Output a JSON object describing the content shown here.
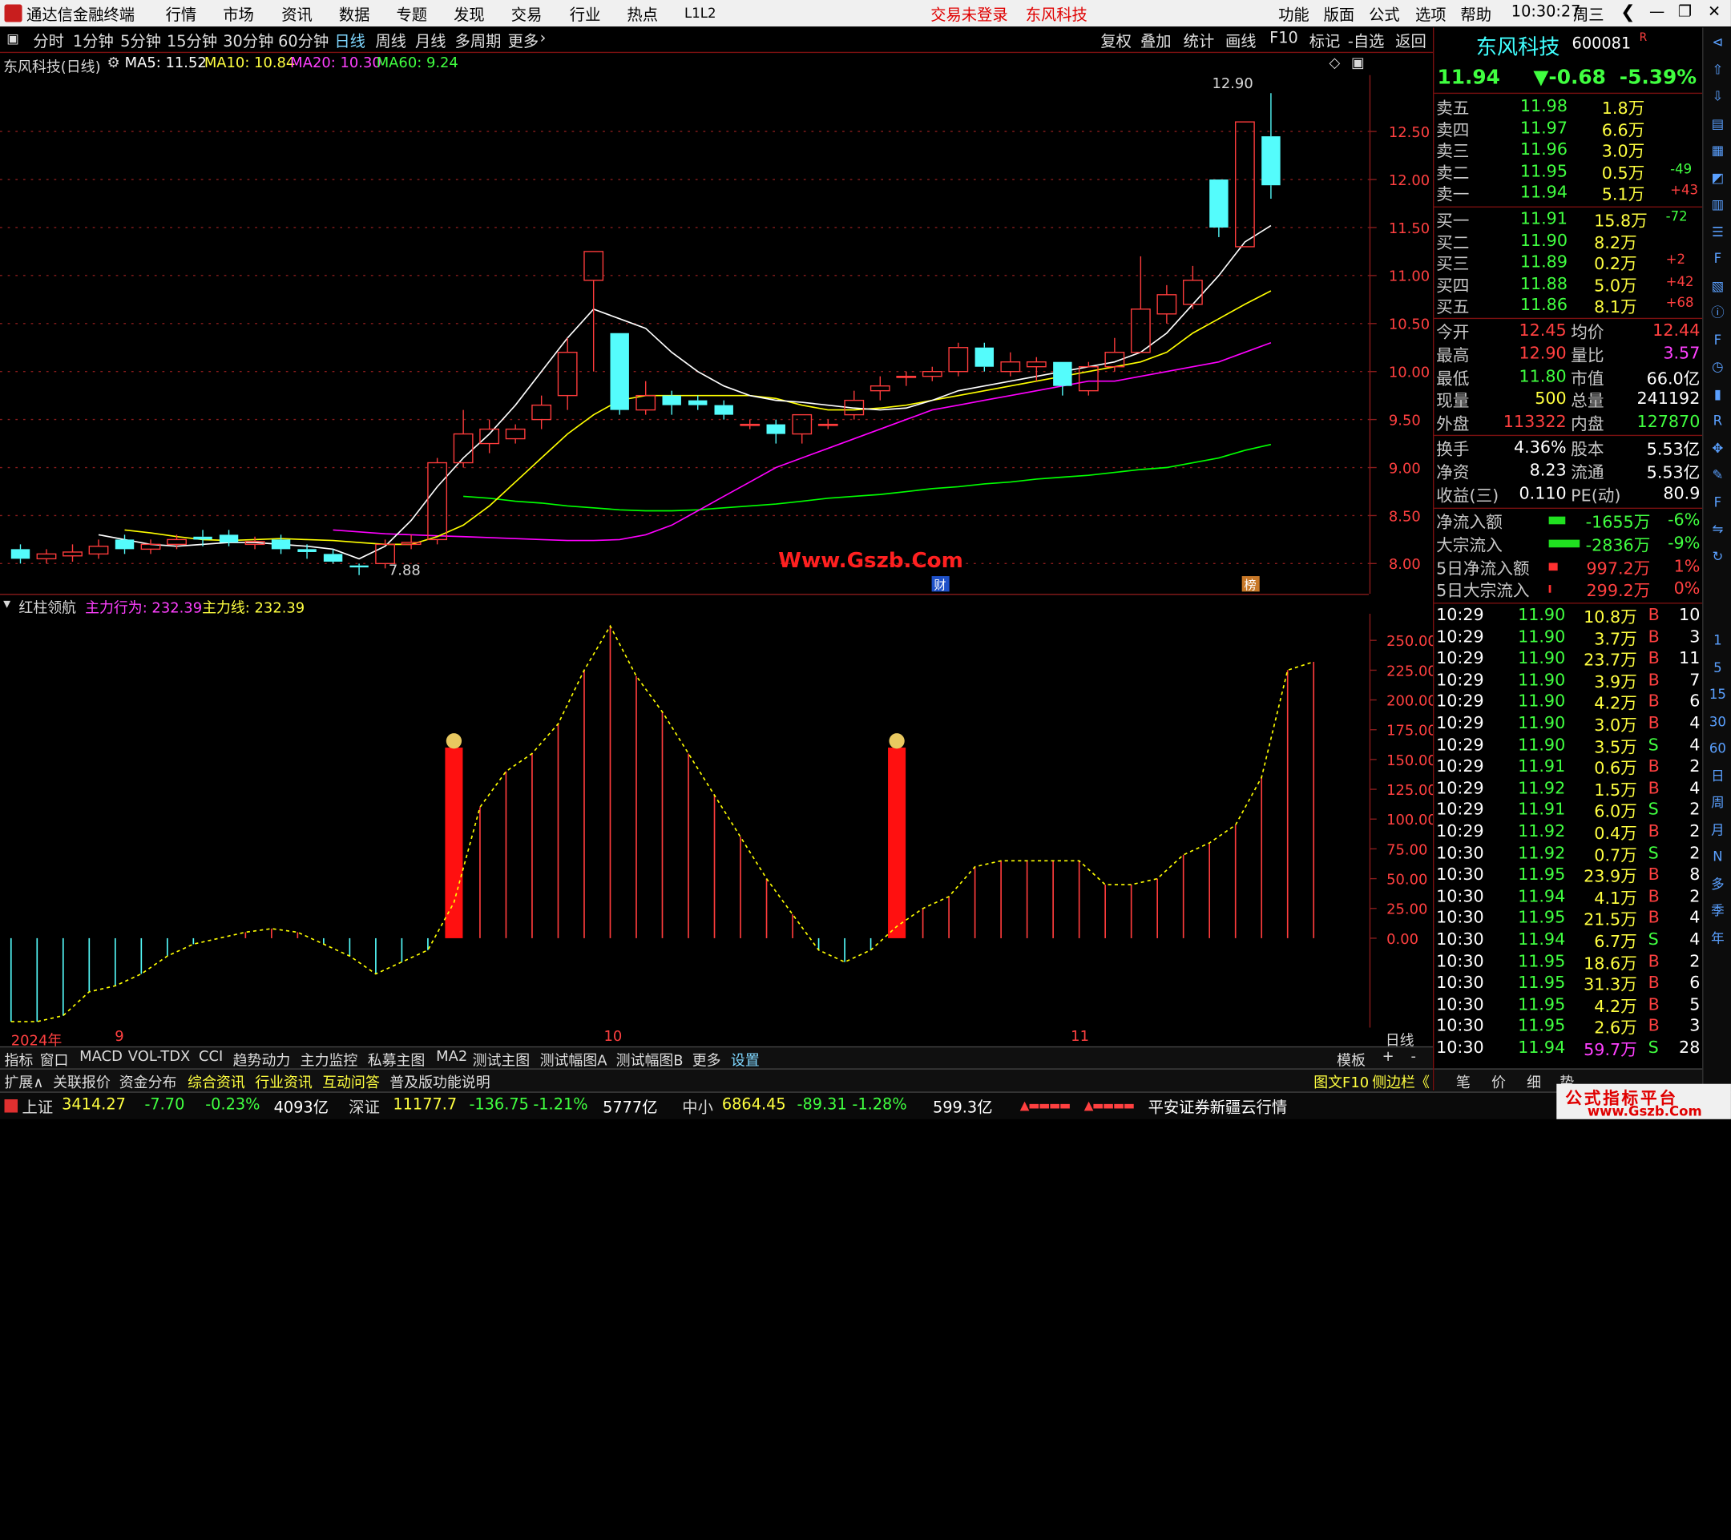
{
  "titlebar": {
    "app_name": "通达信金融终端",
    "menus": [
      "行情",
      "市场",
      "资讯",
      "数据",
      "专题",
      "发现",
      "交易",
      "行业",
      "热点",
      "L1L2"
    ],
    "notice": "交易未登录",
    "stock": "东风科技",
    "right_menus": [
      "功能",
      "版面",
      "公式",
      "选项",
      "帮助"
    ],
    "time": "10:30:27",
    "weekday": "周三"
  },
  "periods": [
    "分时",
    "1分钟",
    "5分钟",
    "15分钟",
    "30分钟",
    "60分钟",
    "日线",
    "周线",
    "月线",
    "多周期",
    "更多"
  ],
  "active_period": "日线",
  "right_tools": [
    "复权",
    "叠加",
    "统计",
    "画线",
    "F10",
    "标记",
    "-自选",
    "返回"
  ],
  "chart_info": {
    "title": "东风科技(日线)",
    "ma5": "MA5: 11.52",
    "ma10": "MA10: 10.84",
    "ma20": "MA20: 10.30",
    "ma60": "MA60: 9.24",
    "high_label": "12.90",
    "low_label": "7.88",
    "watermark": "Www.Gszb.Com",
    "marker1": "财",
    "marker2": "榜"
  },
  "ind_info": {
    "name": "红柱领航",
    "line1": "主力行为: 232.39",
    "line2": "主力线: 232.39"
  },
  "chart_data": [
    {
      "type": "candlestick",
      "y_axis": [
        "12.50",
        "12.00",
        "11.50",
        "11.00",
        "10.50",
        "10.00",
        "9.50",
        "9.00",
        "8.50",
        "8.00"
      ],
      "ylim": [
        7.8,
        12.95
      ],
      "candles": [
        [
          8.15,
          8.05,
          8.2,
          8.0
        ],
        [
          8.05,
          8.1,
          8.15,
          8.0
        ],
        [
          8.08,
          8.12,
          8.2,
          8.02
        ],
        [
          8.1,
          8.18,
          8.25,
          8.05
        ],
        [
          8.25,
          8.15,
          8.3,
          8.1
        ],
        [
          8.15,
          8.2,
          8.25,
          8.1
        ],
        [
          8.2,
          8.25,
          8.3,
          8.15
        ],
        [
          8.28,
          8.25,
          8.35,
          8.18
        ],
        [
          8.3,
          8.22,
          8.35,
          8.18
        ],
        [
          8.2,
          8.23,
          8.28,
          8.15
        ],
        [
          8.25,
          8.15,
          8.3,
          8.1
        ],
        [
          8.15,
          8.12,
          8.2,
          8.05
        ],
        [
          8.1,
          8.02,
          8.15,
          8.0
        ],
        [
          7.98,
          7.96,
          8.0,
          7.88
        ],
        [
          8.0,
          8.2,
          8.25,
          7.95
        ],
        [
          8.2,
          8.22,
          8.3,
          8.15
        ],
        [
          8.25,
          9.05,
          9.1,
          8.2
        ],
        [
          9.05,
          9.35,
          9.6,
          9.0
        ],
        [
          9.25,
          9.4,
          9.5,
          9.15
        ],
        [
          9.3,
          9.4,
          9.45,
          9.25
        ],
        [
          9.5,
          9.65,
          9.75,
          9.4
        ],
        [
          9.75,
          10.2,
          10.35,
          9.6
        ],
        [
          10.95,
          11.25,
          11.25,
          10.0
        ],
        [
          10.4,
          9.6,
          10.4,
          9.55
        ],
        [
          9.6,
          9.75,
          9.9,
          9.55
        ],
        [
          9.75,
          9.65,
          9.8,
          9.55
        ],
        [
          9.7,
          9.65,
          9.75,
          9.6
        ],
        [
          9.65,
          9.55,
          9.7,
          9.5
        ],
        [
          9.45,
          9.45,
          9.5,
          9.4
        ],
        [
          9.45,
          9.35,
          9.5,
          9.25
        ],
        [
          9.35,
          9.55,
          9.55,
          9.25
        ],
        [
          9.45,
          9.45,
          9.5,
          9.4
        ],
        [
          9.55,
          9.7,
          9.8,
          9.5
        ],
        [
          9.8,
          9.85,
          9.95,
          9.7
        ],
        [
          9.95,
          9.95,
          10.0,
          9.85
        ],
        [
          9.95,
          10.0,
          10.05,
          9.9
        ],
        [
          10.0,
          10.25,
          10.3,
          9.95
        ],
        [
          10.25,
          10.05,
          10.3,
          10.0
        ],
        [
          10.0,
          10.1,
          10.2,
          9.95
        ],
        [
          10.05,
          10.1,
          10.15,
          9.9
        ],
        [
          10.1,
          9.85,
          10.1,
          9.75
        ],
        [
          9.8,
          10.05,
          10.1,
          9.75
        ],
        [
          10.05,
          10.2,
          10.35,
          10.0
        ],
        [
          10.2,
          10.65,
          11.2,
          10.2
        ],
        [
          10.6,
          10.8,
          10.9,
          10.5
        ],
        [
          10.7,
          10.95,
          11.1,
          10.65
        ],
        [
          12.0,
          11.5,
          12.0,
          11.4
        ],
        [
          11.3,
          12.6,
          12.6,
          11.3
        ],
        [
          12.45,
          11.94,
          12.9,
          11.8
        ]
      ],
      "ma5": [
        8.3,
        8.25,
        8.2,
        8.18,
        8.2,
        8.22,
        8.22,
        8.2,
        8.18,
        8.15,
        8.05,
        8.18,
        8.45,
        8.8,
        9.1,
        9.35,
        9.65,
        10.0,
        10.35,
        10.65,
        10.55,
        10.45,
        10.2,
        10.0,
        9.85,
        9.75,
        9.7,
        9.68,
        9.65,
        9.62,
        9.6,
        9.62,
        9.7,
        9.8,
        9.85,
        9.9,
        9.95,
        10.0,
        10.05,
        10.1,
        10.2,
        10.4,
        10.7,
        11.0,
        11.35,
        11.52
      ],
      "ma10": [
        8.35,
        8.32,
        8.28,
        8.25,
        8.24,
        8.25,
        8.26,
        8.25,
        8.24,
        8.22,
        8.2,
        8.2,
        8.28,
        8.4,
        8.6,
        8.85,
        9.1,
        9.35,
        9.55,
        9.7,
        9.75,
        9.75,
        9.75,
        9.75,
        9.75,
        9.72,
        9.65,
        9.6,
        9.6,
        9.62,
        9.65,
        9.7,
        9.75,
        9.8,
        9.85,
        9.9,
        9.95,
        10.0,
        10.05,
        10.1,
        10.2,
        10.4,
        10.55,
        10.7,
        10.84
      ],
      "ma20": [
        8.35,
        8.33,
        8.31,
        8.3,
        8.29,
        8.28,
        8.27,
        8.26,
        8.25,
        8.24,
        8.24,
        8.25,
        8.3,
        8.4,
        8.55,
        8.7,
        8.85,
        9.0,
        9.1,
        9.2,
        9.3,
        9.4,
        9.5,
        9.6,
        9.65,
        9.7,
        9.75,
        9.8,
        9.85,
        9.9,
        9.9,
        9.95,
        10.0,
        10.05,
        10.1,
        10.2,
        10.3
      ],
      "ma60": [
        8.7,
        8.68,
        8.65,
        8.63,
        8.6,
        8.58,
        8.56,
        8.55,
        8.55,
        8.56,
        8.58,
        8.6,
        8.62,
        8.65,
        8.68,
        8.7,
        8.72,
        8.75,
        8.78,
        8.8,
        8.83,
        8.85,
        8.88,
        8.9,
        8.92,
        8.95,
        8.98,
        9.0,
        9.05,
        9.1,
        9.18,
        9.24
      ]
    },
    {
      "type": "bar",
      "y_axis": [
        "250.00",
        "225.00",
        "200.00",
        "175.00",
        "150.00",
        "125.00",
        "100.00",
        "75.00",
        "50.00",
        "25.00",
        "0.00"
      ],
      "ylim": [
        -75,
        265
      ],
      "values": [
        -70,
        -70,
        -65,
        -45,
        -40,
        -30,
        -15,
        -5,
        0,
        5,
        8,
        5,
        -5,
        -15,
        -30,
        -20,
        -10,
        30,
        110,
        140,
        155,
        180,
        225,
        262,
        220,
        190,
        155,
        120,
        85,
        50,
        20,
        -10,
        -20,
        -10,
        10,
        25,
        35,
        60,
        65,
        65,
        65,
        65,
        45,
        45,
        50,
        70,
        80,
        95,
        135,
        225,
        232
      ],
      "red_columns": [
        17,
        34
      ]
    }
  ],
  "x_labels": [
    "2024年",
    "9",
    "10",
    "11"
  ],
  "x_right": "日线",
  "tabs1": [
    "指标",
    "窗口",
    "MACD",
    "VOL-TDX",
    "CCI",
    "趋势动力",
    "主力监控",
    "私募主图",
    "MA2",
    "测试主图",
    "测试幅图A",
    "测试幅图B",
    "更多",
    "设置"
  ],
  "tabs1_right": [
    "模板",
    "+",
    "-"
  ],
  "tabs2": [
    "扩展∧",
    "关联报价",
    "资金分布",
    "综合资讯",
    "行业资讯",
    "互动问答",
    "普及版功能说明"
  ],
  "tabs2_right": [
    "图文F10",
    "侧边栏《",
    "笔",
    "价",
    "细",
    "势"
  ],
  "status": {
    "sh_name": "上证",
    "sh_val": "3414.27",
    "sh_chg": "-7.70",
    "sh_pct": "-0.23%",
    "sh_amt": "4093亿",
    "sz_name": "深证",
    "sz_val": "11177.7",
    "sz_chg": "-136.75",
    "sz_pct": "-1.21%",
    "sz_amt": "5777亿",
    "zx_name": "中小",
    "zx_val": "6864.45",
    "zx_chg": "-89.31",
    "zx_pct": "-1.28%",
    "zx_amt": "599.3亿",
    "broker": "平安证券新疆云行情",
    "footer_logo": "公式指标平台",
    "footer_url": "www.Gszb.Com"
  },
  "quote": {
    "name": "东风科技",
    "code": "600081",
    "tag": "R",
    "price": "11.94",
    "change": "▼-0.68",
    "pct": "-5.39%",
    "asks": [
      [
        "卖五",
        "11.98",
        "1.8万",
        ""
      ],
      [
        "卖四",
        "11.97",
        "6.6万",
        ""
      ],
      [
        "卖三",
        "11.96",
        "3.0万",
        ""
      ],
      [
        "卖二",
        "11.95",
        "0.5万",
        "-49"
      ],
      [
        "卖一",
        "11.94",
        "5.1万",
        "+43"
      ]
    ],
    "bids": [
      [
        "买一",
        "11.91",
        "15.8万",
        "-72"
      ],
      [
        "买二",
        "11.90",
        "8.2万",
        ""
      ],
      [
        "买三",
        "11.89",
        "0.2万",
        "+2"
      ],
      [
        "买四",
        "11.88",
        "5.0万",
        "+42"
      ],
      [
        "买五",
        "11.86",
        "8.1万",
        "+68"
      ]
    ],
    "stats": [
      [
        "今开",
        "12.45",
        "均价",
        "12.44"
      ],
      [
        "最高",
        "12.90",
        "量比",
        "3.57"
      ],
      [
        "最低",
        "11.80",
        "市值",
        "66.0亿"
      ],
      [
        "现量",
        "500",
        "总量",
        "241192"
      ],
      [
        "外盘",
        "113322",
        "内盘",
        "127870"
      ]
    ],
    "stats2": [
      [
        "换手",
        "4.36%",
        "股本",
        "5.53亿"
      ],
      [
        "净资",
        "8.23",
        "流通",
        "5.53亿"
      ],
      [
        "收益(三)",
        "0.110",
        "PE(动)",
        "80.9"
      ]
    ],
    "flows": [
      [
        "净流入额",
        "-1655万",
        "-6%"
      ],
      [
        "大宗流入",
        "-2836万",
        "-9%"
      ],
      [
        "5日净流入额",
        "997.2万",
        "1%"
      ],
      [
        "5日大宗流入",
        "299.2万",
        "0%"
      ]
    ],
    "ticks": [
      [
        "10:29",
        "11.90",
        "10.8万",
        "B",
        "10"
      ],
      [
        "10:29",
        "11.90",
        "3.7万",
        "B",
        "3"
      ],
      [
        "10:29",
        "11.90",
        "23.7万",
        "B",
        "11"
      ],
      [
        "10:29",
        "11.90",
        "3.9万",
        "B",
        "7"
      ],
      [
        "10:29",
        "11.90",
        "4.2万",
        "B",
        "6"
      ],
      [
        "10:29",
        "11.90",
        "3.0万",
        "B",
        "4"
      ],
      [
        "10:29",
        "11.90",
        "3.5万",
        "S",
        "4"
      ],
      [
        "10:29",
        "11.91",
        "0.6万",
        "B",
        "2"
      ],
      [
        "10:29",
        "11.92",
        "1.5万",
        "B",
        "4"
      ],
      [
        "10:29",
        "11.91",
        "6.0万",
        "S",
        "2"
      ],
      [
        "10:29",
        "11.92",
        "0.4万",
        "B",
        "2"
      ],
      [
        "10:30",
        "11.92",
        "0.7万",
        "S",
        "2"
      ],
      [
        "10:30",
        "11.95",
        "23.9万",
        "B",
        "8"
      ],
      [
        "10:30",
        "11.94",
        "4.1万",
        "B",
        "2"
      ],
      [
        "10:30",
        "11.95",
        "21.5万",
        "B",
        "4"
      ],
      [
        "10:30",
        "11.94",
        "6.7万",
        "S",
        "4"
      ],
      [
        "10:30",
        "11.95",
        "18.6万",
        "B",
        "2"
      ],
      [
        "10:30",
        "11.95",
        "31.3万",
        "B",
        "6"
      ],
      [
        "10:30",
        "11.95",
        "4.2万",
        "B",
        "5"
      ],
      [
        "10:30",
        "11.95",
        "2.6万",
        "B",
        "3"
      ],
      [
        "10:30",
        "11.94",
        "59.7万",
        "S",
        "28"
      ]
    ]
  },
  "side_icons": [
    "collapse-icon",
    "up-icon",
    "down-icon",
    "news-icon",
    "grid-icon",
    "chart-icon",
    "kline-icon",
    "list-icon",
    "f10-icon",
    "doc-icon",
    "info-icon",
    "f2-icon",
    "clock-icon",
    "bars-icon",
    "rsi-icon",
    "move-icon",
    "pen-icon",
    "fs-icon",
    "share-icon",
    "refresh-icon"
  ],
  "side_labels": [
    "1",
    "5",
    "15",
    "30",
    "60",
    "日",
    "周",
    "月",
    "N",
    "多",
    "季",
    "年"
  ],
  "colors": {
    "up": "#ff3c3c",
    "down": "#54fcfc",
    "ma5": "#ffffff",
    "ma10": "#ffff00",
    "ma20": "#ff00ff",
    "ma60": "#00ff00",
    "grid": "#8a1c1c"
  }
}
